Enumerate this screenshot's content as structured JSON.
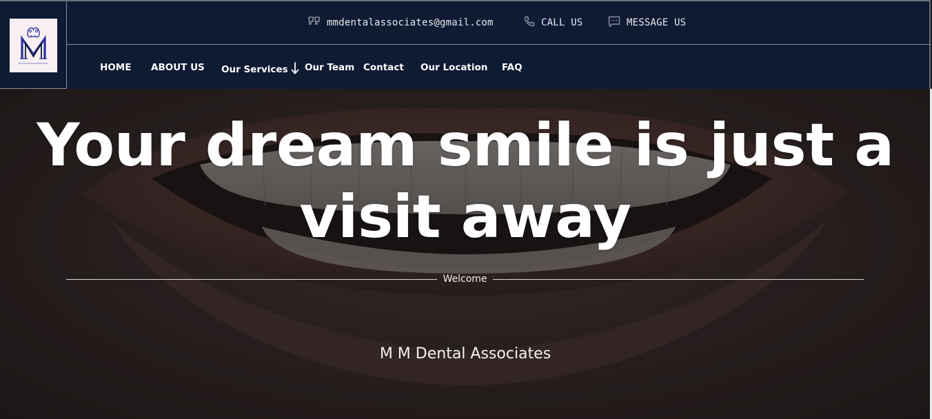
{
  "brand": {
    "logo_monogram": "M",
    "logo_caption": "MM DENTAL ASSOCIATES"
  },
  "topbar": {
    "email": {
      "icon": "quote-icon",
      "text": "mmdentalassociates@gmail.com"
    },
    "call": {
      "icon": "phone-icon",
      "text": "CALL US"
    },
    "message": {
      "icon": "chat-icon",
      "text": "MESSAGE US"
    }
  },
  "nav": {
    "items": [
      {
        "label": "HOME"
      },
      {
        "label": "ABOUT US"
      },
      {
        "label": "Our Services",
        "icon": "arrow-down-icon"
      },
      {
        "label": "Our Team"
      },
      {
        "label": "Contact"
      },
      {
        "label": "Our Location"
      },
      {
        "label": "FAQ"
      }
    ]
  },
  "hero": {
    "headline_line1": "Your dream smile is just a",
    "headline_line2": "visit away",
    "divider_label": "Welcome",
    "subtitle": "M M Dental Associates"
  },
  "colors": {
    "header_bg": "#0f1a33",
    "text": "#ffffff",
    "logo_bg": "#f7eff3",
    "logo_accent": "#2b2f9e"
  }
}
